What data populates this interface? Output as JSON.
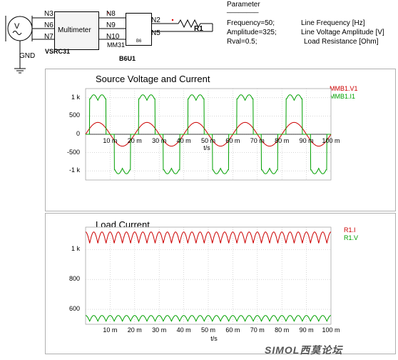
{
  "schematic": {
    "source_name": "VSRC31",
    "source_symbol": "V",
    "gnd_label": "GND",
    "nets_left": [
      "N3",
      "N6",
      "N7"
    ],
    "nets_mid": [
      "N8",
      "N9",
      "N10"
    ],
    "nets_right": [
      "N2",
      "N5"
    ],
    "multimeter_label": "Multimeter",
    "multimeter_name": "MM31",
    "bridge_label": "B6",
    "bridge_name": "B6U1",
    "resistor_name": "R1"
  },
  "parameters": {
    "title": "Parameter",
    "separator": "________",
    "lines": [
      {
        "assign": "Frequency=50;",
        "desc": "Line Frequency [Hz]"
      },
      {
        "assign": "Amplitude=325;",
        "desc": "Line Voltage Amplitude [V]"
      },
      {
        "assign": "Rval=0.5;",
        "desc": "Load Resistance [Ohm]"
      }
    ]
  },
  "chart_data": [
    {
      "type": "line",
      "title": "Source Voltage and Current",
      "xlabel": "t/s",
      "ylabel": "",
      "x_ticks": [
        "10 m",
        "20 m",
        "30 m",
        "40 m",
        "50 m",
        "60 m",
        "70 m",
        "80 m",
        "90 m",
        "100 m"
      ],
      "y_ticks": [
        "1 k",
        "500",
        "0",
        "-500",
        "-1 k"
      ],
      "xlim": [
        0,
        0.1
      ],
      "ylim": [
        -1250,
        1250
      ],
      "grid": true,
      "legend_position": "top-right",
      "series": [
        {
          "name": "MMB1.V1",
          "color": "#cc0000",
          "kind": "sine",
          "amplitude": 325,
          "frequency": 50
        },
        {
          "name": "MMB1.I1",
          "color": "#00a000",
          "kind": "pulse",
          "amplitude": 1080,
          "frequency": 50
        }
      ]
    },
    {
      "type": "line",
      "title": "Load Current",
      "xlabel": "t/s",
      "ylabel": "",
      "x_ticks": [
        "10 m",
        "20 m",
        "30 m",
        "40 m",
        "50 m",
        "60 m",
        "70 m",
        "80 m",
        "90 m",
        "100 m"
      ],
      "y_ticks": [
        "1 k",
        "800",
        "600"
      ],
      "xlim": [
        0,
        0.1
      ],
      "ylim": [
        500,
        1150
      ],
      "grid": true,
      "legend_position": "top-right",
      "series": [
        {
          "name": "R1.I",
          "color": "#cc0000",
          "kind": "ripple",
          "mean": 1080,
          "amplitude": 75,
          "frequency": 300
        },
        {
          "name": "R1.V",
          "color": "#00a000",
          "kind": "ripple",
          "mean": 540,
          "amplitude": 38,
          "frequency": 300
        }
      ]
    }
  ],
  "watermark": "SIMOL西莫论坛"
}
